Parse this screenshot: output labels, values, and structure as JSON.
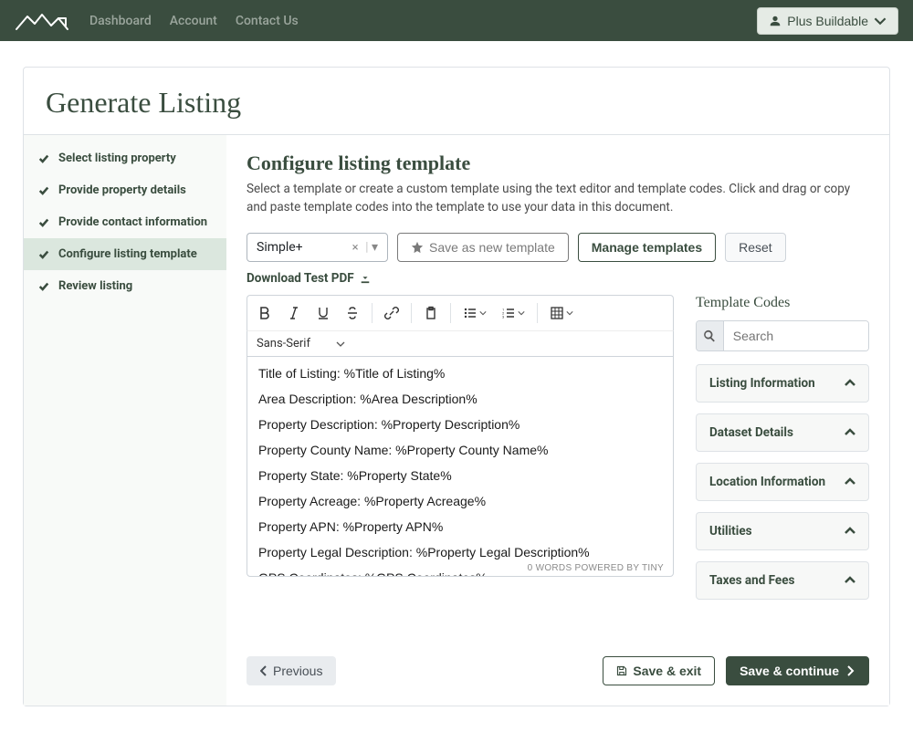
{
  "nav": {
    "links": [
      "Dashboard",
      "Account",
      "Contact Us"
    ],
    "user_label": "Plus Buildable"
  },
  "page": {
    "title": "Generate Listing"
  },
  "steps": [
    "Select listing property",
    "Provide property details",
    "Provide contact information",
    "Configure listing template",
    "Review listing"
  ],
  "active_step_index": 3,
  "section": {
    "title": "Configure listing template",
    "description": "Select a template or create a custom template using the text editor and template codes. Click and drag or copy and paste template codes into the template to use your data in this document."
  },
  "controls": {
    "selected_template": "Simple+",
    "save_as_new": "Save as new template",
    "manage_templates": "Manage templates",
    "reset": "Reset",
    "download_test_pdf": "Download Test PDF"
  },
  "editor": {
    "font_family": "Sans-Serif",
    "footer": "0 WORDS  POWERED BY TINY",
    "content_lines": [
      "Title of Listing: %Title of Listing%",
      "Area Description: %Area Description%",
      "Property Description:  %Property Description%",
      "Property County Name: %Property County Name%",
      "Property State: %Property State%",
      "Property Acreage: %Property Acreage%",
      "Property APN: %Property APN%",
      "Property Legal Description: %Property Legal Description%",
      "GPS Coordinates: %GPS Coordinates%"
    ]
  },
  "template_codes": {
    "title": "Template Codes",
    "search_placeholder": "Search",
    "groups": [
      "Listing Information",
      "Dataset Details",
      "Location Information",
      "Utilities",
      "Taxes and Fees"
    ]
  },
  "footer": {
    "previous": "Previous",
    "save_exit": "Save & exit",
    "save_continue": "Save & continue"
  }
}
